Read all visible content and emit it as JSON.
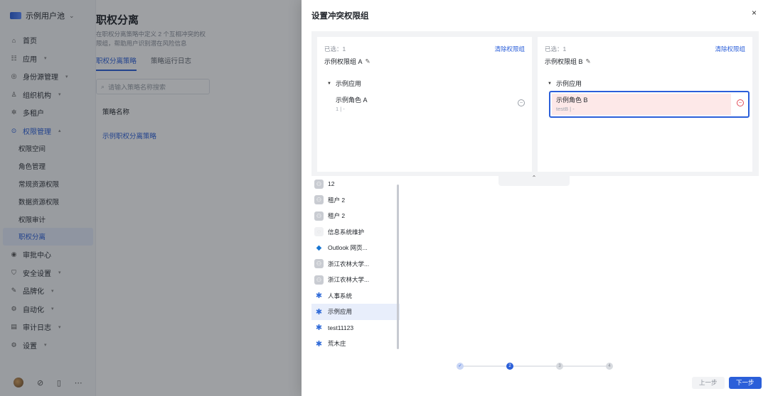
{
  "app": {
    "pool_name": "示例用户池",
    "nav": [
      {
        "icon": "home-icon",
        "glyph": "⌂",
        "label": "首页",
        "arrow": ""
      },
      {
        "icon": "apps-icon",
        "glyph": "☷",
        "label": "应用",
        "arrow": "▾"
      },
      {
        "icon": "identity-icon",
        "glyph": "◎",
        "label": "身份源管理",
        "arrow": "▾"
      },
      {
        "icon": "org-icon",
        "glyph": "♙",
        "label": "组织机构",
        "arrow": "▾"
      },
      {
        "icon": "tenant-icon",
        "glyph": "✲",
        "label": "多租户",
        "arrow": ""
      },
      {
        "icon": "permission-icon",
        "glyph": "⊙",
        "label": "权限管理",
        "arrow": "▴"
      }
    ],
    "nav_sub": [
      "权限空间",
      "角色管理",
      "常规资源权限",
      "数据资源权限",
      "权限审计",
      "职权分离"
    ],
    "nav_after": [
      {
        "icon": "approval-icon",
        "glyph": "◉",
        "label": "审批中心",
        "arrow": ""
      },
      {
        "icon": "security-icon",
        "glyph": "⛉",
        "label": "安全设置",
        "arrow": "▾"
      },
      {
        "icon": "branding-icon",
        "glyph": "✎",
        "label": "品牌化",
        "arrow": "▾"
      },
      {
        "icon": "automation-icon",
        "glyph": "⚙",
        "label": "自动化",
        "arrow": "▾"
      },
      {
        "icon": "audit-log-icon",
        "glyph": "▤",
        "label": "审计日志",
        "arrow": "▾"
      },
      {
        "icon": "settings-icon",
        "glyph": "⚙",
        "label": "设置",
        "arrow": "▾"
      }
    ]
  },
  "page": {
    "title": "职权分离",
    "desc": "在职权分离策略中定义 2 个互相冲突的权限组，帮助用户识别潜在风险信息",
    "tabs": [
      "职权分离策略",
      "策略运行日志"
    ],
    "search_placeholder": "请输入策略名称搜索",
    "col_name": "策略名称",
    "row_name": "示例职权分离策略"
  },
  "drawer": {
    "title": "设置冲突权限组",
    "close": "×",
    "panel_a": {
      "selected": "已选：1",
      "clear": "清除权限组",
      "group_name": "示例权限组 A",
      "app_name": "示例应用",
      "role_name": "示例角色 A",
      "role_sub": "1 | -"
    },
    "panel_b": {
      "selected": "已选：1",
      "clear": "清除权限组",
      "group_name": "示例权限组 B",
      "app_name": "示例应用",
      "role_name": "示例角色 B",
      "role_sub": "testB | -"
    },
    "collapse_glyph": "⌃",
    "apps": [
      {
        "label": "12",
        "icon": "grey"
      },
      {
        "label": "租户 2",
        "icon": "grey"
      },
      {
        "label": "租户 2",
        "icon": "grey"
      },
      {
        "label": "信息系统维护",
        "icon": "faint"
      },
      {
        "label": "Outlook 网页...",
        "icon": "outlook"
      },
      {
        "label": "浙江农林大学...",
        "icon": "grey"
      },
      {
        "label": "浙江农林大学...",
        "icon": "grey"
      },
      {
        "label": "人事系统",
        "icon": "blue"
      },
      {
        "label": "示例应用",
        "icon": "blue",
        "selected": true
      },
      {
        "label": "test11123",
        "icon": "blue"
      },
      {
        "label": "荒木庄",
        "icon": "blue"
      }
    ],
    "steps": [
      {
        "label": "✓",
        "state": "done"
      },
      {
        "label": "2",
        "state": "current"
      },
      {
        "label": "3",
        "state": "todo"
      },
      {
        "label": "4",
        "state": "todo"
      }
    ],
    "prev_label": "上一步",
    "next_label": "下一步"
  },
  "colors": {
    "accent": "#2b5fd9",
    "conflict_bg": "#fde8e8",
    "danger": "#e34d59"
  }
}
